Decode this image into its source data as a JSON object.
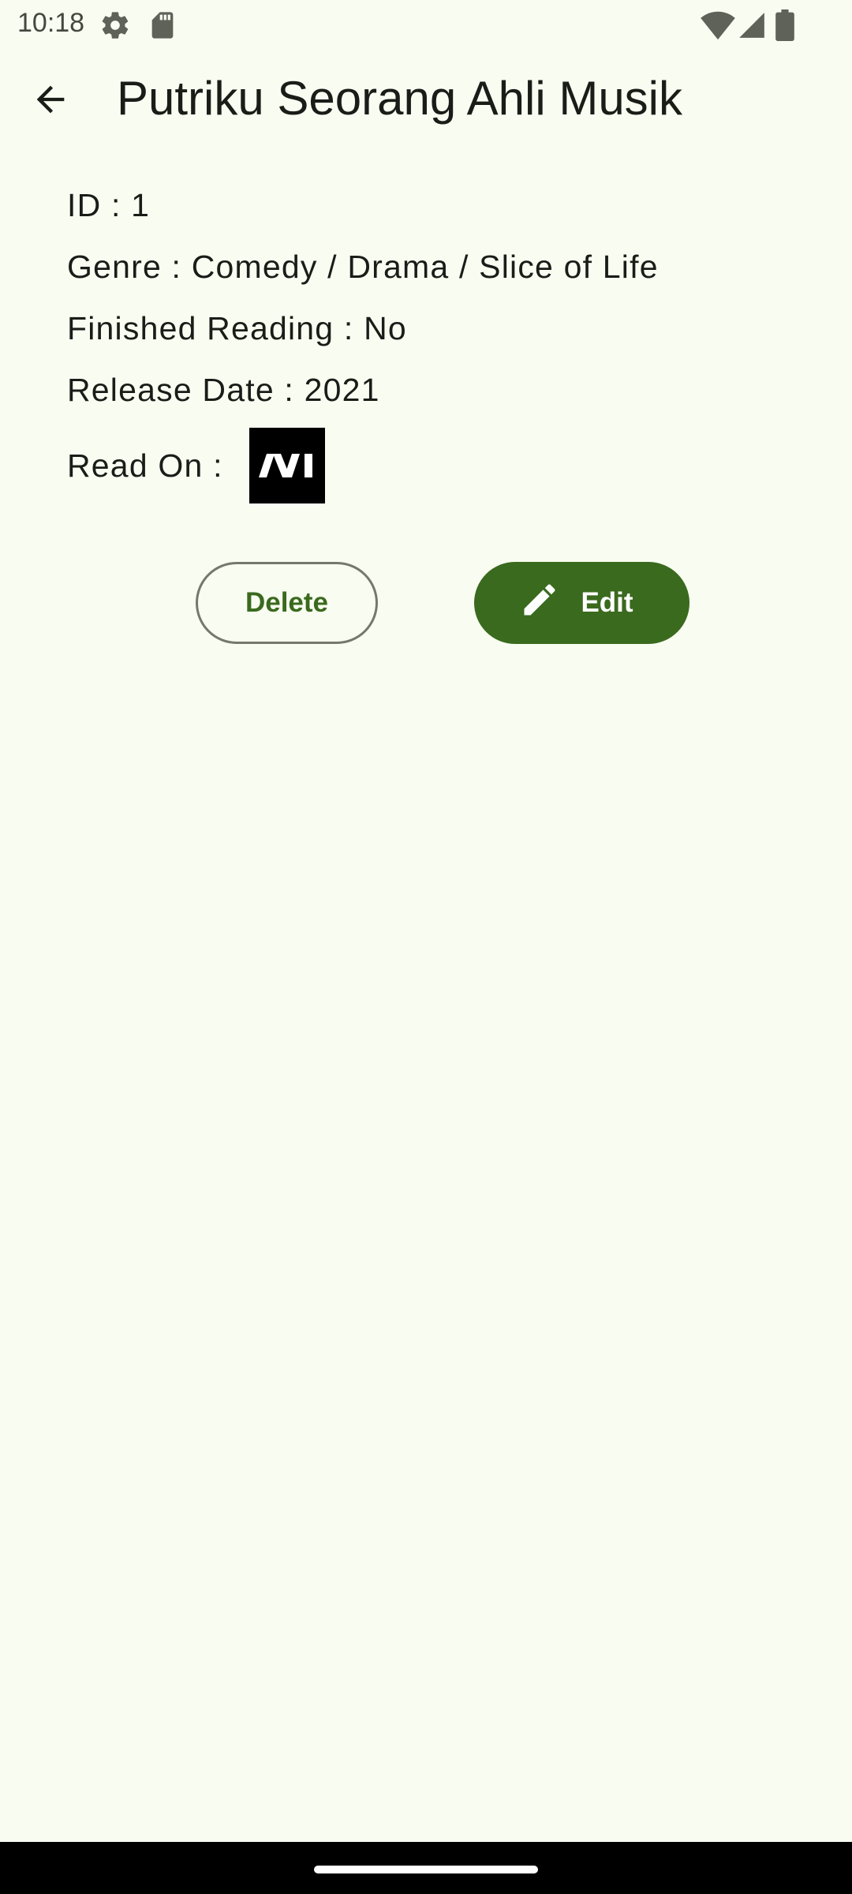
{
  "status_bar": {
    "time": "10:18",
    "left_icons": [
      "settings-gear-icon",
      "sd-card-icon"
    ],
    "right_icons": [
      "wifi-icon",
      "cellular-signal-icon",
      "battery-icon"
    ]
  },
  "app_bar": {
    "back_icon": "arrow-back-icon",
    "title": "Putriku Seorang Ahli Musik"
  },
  "details": {
    "id": "ID : 1",
    "genre": "Genre : Comedy / Drama / Slice of Life",
    "finished_reading": "Finished Reading : No",
    "release_date": "Release Date : 2021",
    "read_on_label": "Read On :",
    "read_on_logo": "platform-logo-icon"
  },
  "actions": {
    "delete_label": "Delete",
    "edit_label": "Edit",
    "edit_icon": "pencil-icon"
  },
  "colors": {
    "background": "#f9fcf1",
    "primary": "#3a6a1e",
    "outline": "#75796c",
    "on_surface": "#1a1c18",
    "nav_bar": "#000000"
  }
}
